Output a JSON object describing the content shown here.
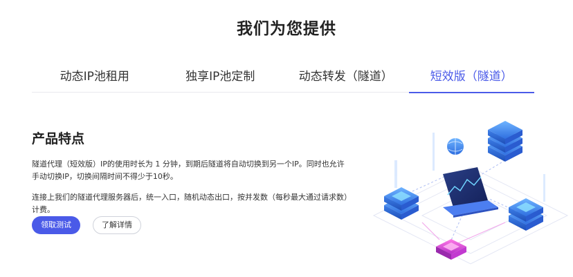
{
  "header": {
    "title": "我们为您提供"
  },
  "tabs": [
    {
      "label": "动态IP池租用",
      "active": false
    },
    {
      "label": "独享IP池定制",
      "active": false
    },
    {
      "label": "动态转发（隧道）",
      "active": false
    },
    {
      "label": "短效版（隧道）",
      "active": true
    }
  ],
  "features": {
    "title": "产品特点",
    "paragraph_1": "隧道代理（短效版）IP的使用时长为 1 分钟，到期后隧道将自动切换到另一个IP。同时也允许手动切换IP，切换间隔时间不得少于10秒。",
    "paragraph_2": "连接上我们的隧道代理服务器后，统一入口，随机动态出口，按并发数（每秒最大通过请求数）计费。"
  },
  "actions": {
    "trial_label": "领取测试",
    "details_label": "了解详情"
  },
  "colors": {
    "accent": "#4a5ae8",
    "server_blue": "#3d8cf0",
    "server_pink": "#e84ad8"
  },
  "illustration": {
    "icon": "network-servers-illustration"
  }
}
